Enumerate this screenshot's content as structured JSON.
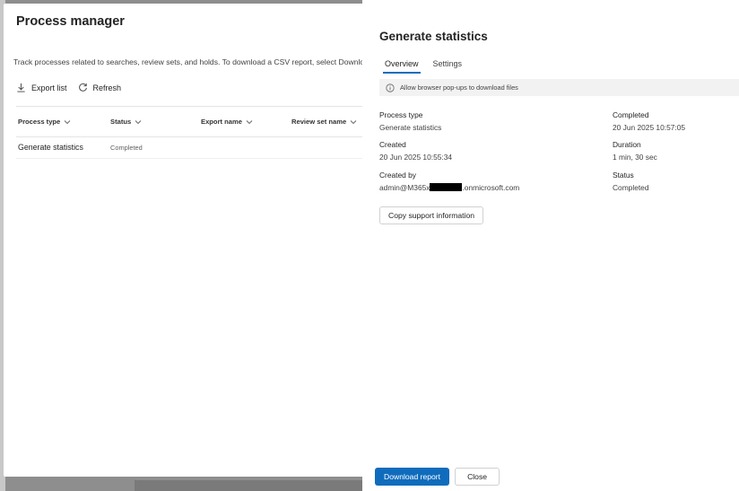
{
  "process_manager": {
    "title": "Process manager",
    "description": "Track processes related to searches, review sets, and holds. To download a CSV report, select Download list",
    "toolbar": {
      "export_label": "Export list",
      "export_icon": "download-icon",
      "refresh_label": "Refresh",
      "refresh_icon": "refresh-icon"
    },
    "columns": [
      "Process type",
      "Status",
      "Export name",
      "Review set name"
    ],
    "rows": [
      {
        "process_type": "Generate statistics",
        "status": "Completed",
        "export_name": "",
        "review_set_name": ""
      }
    ]
  },
  "panel": {
    "title": "Generate statistics",
    "tabs": [
      {
        "label": "Overview",
        "active": true
      },
      {
        "label": "Settings",
        "active": false
      }
    ],
    "info_message": "Allow browser pop-ups to download files",
    "fields": {
      "process_type": {
        "label": "Process type",
        "value": "Generate statistics"
      },
      "completed": {
        "label": "Completed",
        "value": "20 Jun 2025 10:57:05"
      },
      "created": {
        "label": "Created",
        "value": "20 Jun 2025 10:55:34"
      },
      "duration": {
        "label": "Duration",
        "value": "1 min, 30 sec"
      },
      "created_by": {
        "label": "Created by",
        "value_prefix": "admin@M365x",
        "value_suffix": ".onmicrosoft.com"
      },
      "status": {
        "label": "Status",
        "value": "Completed"
      }
    },
    "copy_support_label": "Copy support information",
    "download_report_label": "Download report",
    "close_label": "Close"
  },
  "colors": {
    "accent": "#0f6cbd",
    "overlay": "#8e8e8e"
  }
}
